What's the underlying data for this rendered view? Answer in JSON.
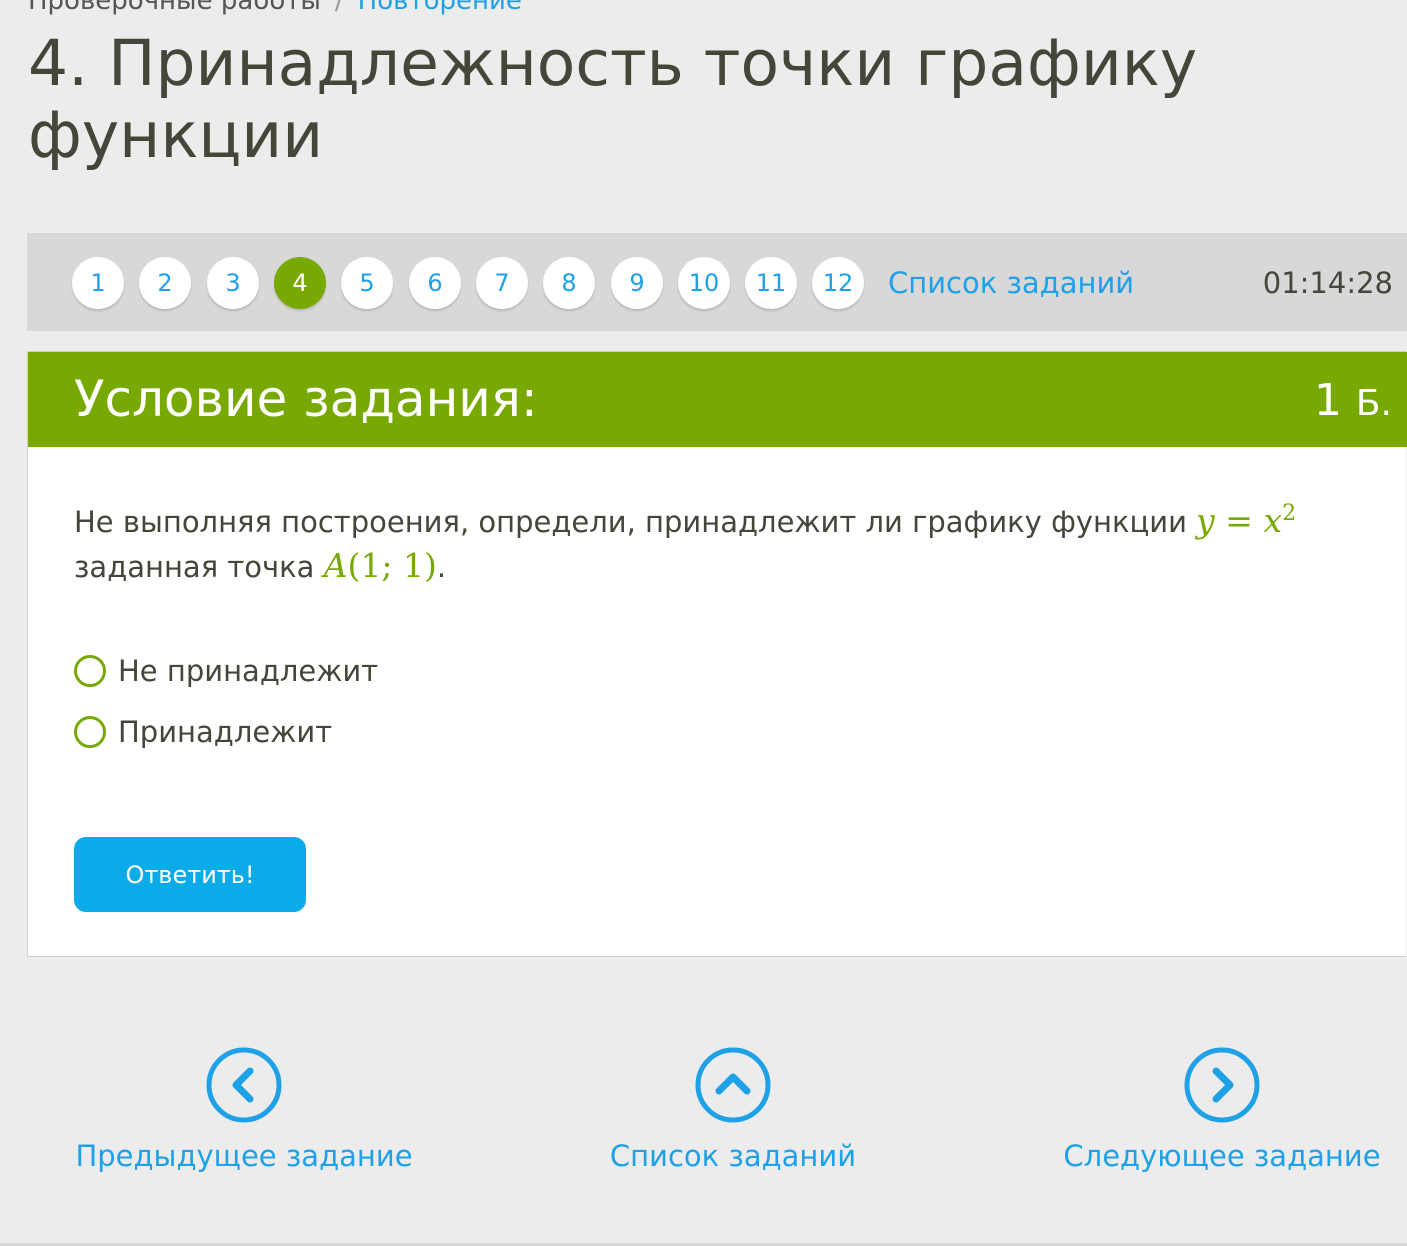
{
  "breadcrumb": {
    "parent": "Проверочные работы",
    "separator": "/",
    "current": "Повторение"
  },
  "page_title": "4. Принадлежность точки графику функции",
  "task_nav": {
    "numbers": [
      "1",
      "2",
      "3",
      "4",
      "5",
      "6",
      "7",
      "8",
      "9",
      "10",
      "11",
      "12"
    ],
    "active": "4",
    "list_link": "Список заданий",
    "timer": "01:14:28"
  },
  "task": {
    "header": "Условие задания:",
    "points_value": "1",
    "points_unit": "Б.",
    "question": {
      "text_before": "Не выполняя построения, определи, принадлежит ли графику функции ",
      "func_lhs": "y",
      "func_eq": " = ",
      "func_var": "x",
      "func_exp": "2",
      "text_middle": " заданная точка ",
      "point_name": "A",
      "point_coords": "(1; 1)",
      "text_after": "."
    },
    "options": [
      "Не принадлежит",
      "Принадлежит"
    ],
    "submit_label": "Ответить!"
  },
  "bottom_nav": {
    "prev_label": "Предыдущее задание",
    "list_label": "Список заданий",
    "next_label": "Следующее задание"
  },
  "colors": {
    "accent_green": "#77a902",
    "link_blue": "#1ea1e6",
    "button_blue": "#0aabe8",
    "background": "#ececec"
  },
  "icons": {
    "prev": "chevron-left-circle-icon",
    "list": "chevron-up-circle-icon",
    "next": "chevron-right-circle-icon"
  }
}
